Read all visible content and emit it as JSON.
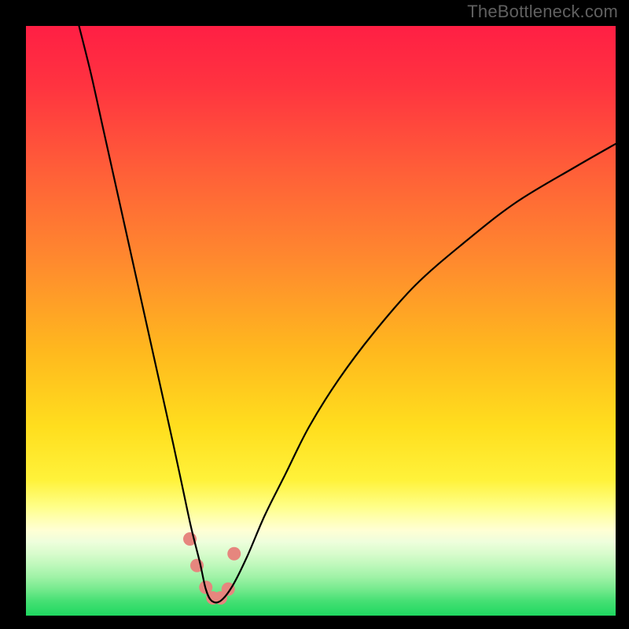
{
  "watermark": "TheBottleneck.com",
  "colors": {
    "frame": "#000000",
    "curve": "#000000",
    "marker": "#e6867e",
    "gradient_stops": [
      {
        "offset": 0.0,
        "color": "#ff1f44"
      },
      {
        "offset": 0.1,
        "color": "#ff3340"
      },
      {
        "offset": 0.25,
        "color": "#ff6038"
      },
      {
        "offset": 0.4,
        "color": "#ff8a2e"
      },
      {
        "offset": 0.55,
        "color": "#ffb81e"
      },
      {
        "offset": 0.68,
        "color": "#ffde1e"
      },
      {
        "offset": 0.77,
        "color": "#fff23a"
      },
      {
        "offset": 0.815,
        "color": "#ffff88"
      },
      {
        "offset": 0.835,
        "color": "#ffffb0"
      },
      {
        "offset": 0.855,
        "color": "#ffffd4"
      },
      {
        "offset": 0.875,
        "color": "#eefedc"
      },
      {
        "offset": 0.895,
        "color": "#d8fccc"
      },
      {
        "offset": 0.915,
        "color": "#bdf8ba"
      },
      {
        "offset": 0.935,
        "color": "#9ef2a6"
      },
      {
        "offset": 0.955,
        "color": "#76ea8e"
      },
      {
        "offset": 0.975,
        "color": "#46e074"
      },
      {
        "offset": 1.0,
        "color": "#1fd860"
      }
    ]
  },
  "chart_data": {
    "type": "line",
    "title": "",
    "xlabel": "",
    "ylabel": "",
    "xlim": [
      0,
      100
    ],
    "ylim": [
      0,
      100
    ],
    "series": [
      {
        "name": "bottleneck-curve",
        "x": [
          9,
          11,
          13,
          15,
          17,
          19,
          21,
          23,
          25,
          26.5,
          28,
          29.5,
          30.5,
          31.5,
          33,
          35,
          37.5,
          40.5,
          44,
          48,
          53,
          59,
          66,
          74,
          83,
          93,
          100
        ],
        "y": [
          100,
          92,
          83,
          74,
          65,
          56,
          47,
          38,
          29,
          22,
          15,
          9,
          4.5,
          2.5,
          2.5,
          5,
          10,
          17,
          24,
          32,
          40,
          48,
          56,
          63,
          70,
          76,
          80
        ]
      }
    ],
    "markers": {
      "name": "highlight-points",
      "x": [
        27.8,
        29.0,
        30.5,
        31.7,
        33.0,
        34.3,
        35.3
      ],
      "y": [
        13.0,
        8.5,
        4.8,
        3.0,
        3.0,
        4.5,
        10.5
      ]
    }
  }
}
